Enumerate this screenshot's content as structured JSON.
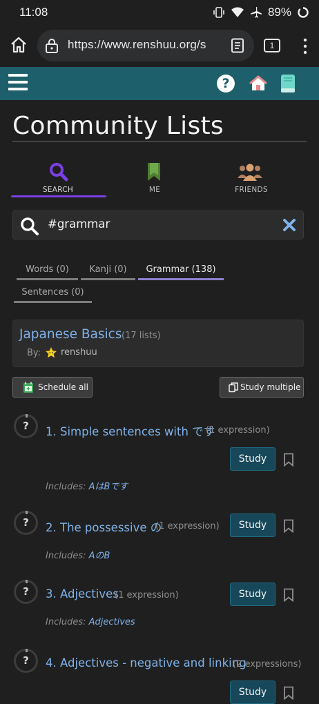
{
  "status_bar": {
    "time": "11:08",
    "battery": "89%"
  },
  "browser": {
    "url": "https://www.renshuu.org/s",
    "tab_count": "1"
  },
  "page": {
    "title": "Community Lists"
  },
  "tabs": [
    {
      "label": "SEARCH",
      "icon": "magnifier-icon",
      "active": true
    },
    {
      "label": "ME",
      "icon": "bookmark-icon",
      "active": false
    },
    {
      "label": "FRIENDS",
      "icon": "people-icon",
      "active": false
    }
  ],
  "search": {
    "value": "#grammar"
  },
  "type_tabs": [
    {
      "label": "Words (0)"
    },
    {
      "label": "Kanji (0)"
    },
    {
      "label": "Grammar (138)"
    },
    {
      "label": "Sentences (0)"
    }
  ],
  "collection": {
    "title": "Japanese Basics",
    "count": "(17 lists)",
    "by_label": "By:",
    "author": "renshuu"
  },
  "actions": {
    "schedule_all": "Schedule all",
    "study_multiple": "Study multiple"
  },
  "study_label": "Study",
  "includes_label": "Includes:",
  "lists": [
    {
      "title": "1. Simple sentences with です",
      "count": "(1 expression)",
      "includes": "AはBです"
    },
    {
      "title": "2. The possessive の",
      "count": "(1 expression)",
      "includes": "AのB"
    },
    {
      "title": "3. Adjectives",
      "count": "(1 expression)",
      "includes": "Adjectives"
    },
    {
      "title": "4. Adjectives - negative and linking",
      "count": "(2 expressions)",
      "includes": ""
    }
  ],
  "colors": {
    "header": "#1e5f6c",
    "accent": "#7b3fe4",
    "link": "#7fb2ea",
    "study_button": "#17485a"
  }
}
